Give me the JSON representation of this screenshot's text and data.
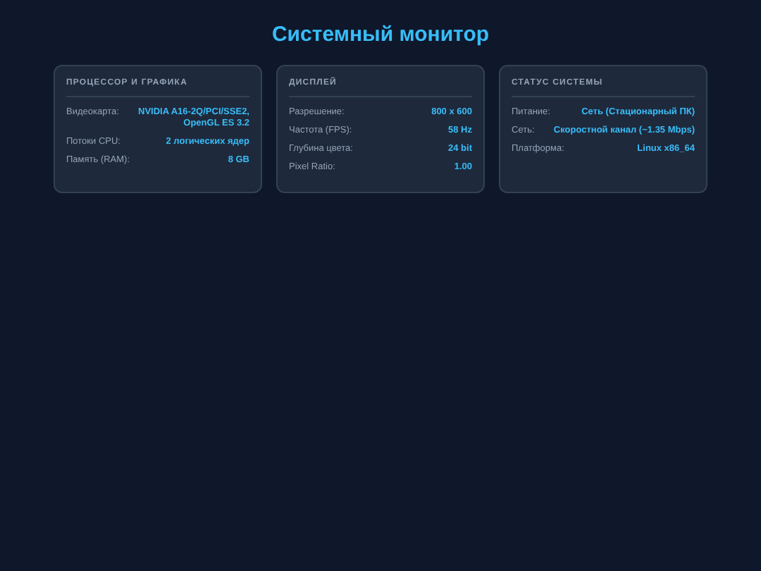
{
  "title": "Системный монитор",
  "cards": [
    {
      "heading": "ПРОЦЕССОР И ГРАФИКА",
      "rows": [
        {
          "label": "Видеокарта:",
          "value": "NVIDIA A16-2Q/PCI/SSE2, OpenGL ES 3.2"
        },
        {
          "label": "Потоки CPU:",
          "value": "2 логических ядер"
        },
        {
          "label": "Память (RAM):",
          "value": "8 GB"
        }
      ]
    },
    {
      "heading": "ДИСПЛЕЙ",
      "rows": [
        {
          "label": "Разрешение:",
          "value": "800 x 600"
        },
        {
          "label": "Частота (FPS):",
          "value": "58 Hz"
        },
        {
          "label": "Глубина цвета:",
          "value": "24 bit"
        },
        {
          "label": "Pixel Ratio:",
          "value": "1.00"
        }
      ]
    },
    {
      "heading": "СТАТУС СИСТЕМЫ",
      "rows": [
        {
          "label": "Питание:",
          "value": "Сеть (Стационарный ПК)"
        },
        {
          "label": "Сеть:",
          "value": "Скоростной канал (~1.35 Mbps)"
        },
        {
          "label": "Платформа:",
          "value": "Linux x86_64"
        }
      ]
    }
  ]
}
